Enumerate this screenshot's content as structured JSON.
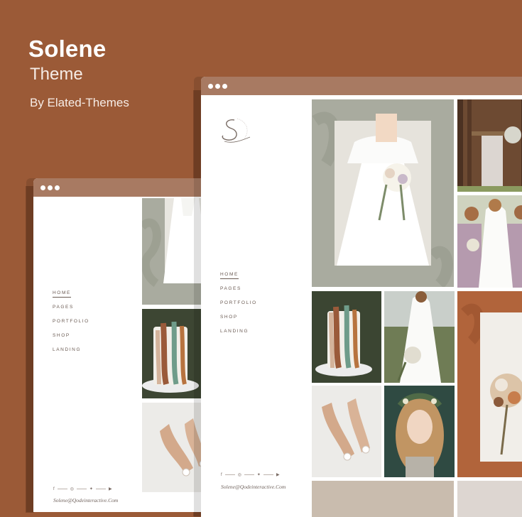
{
  "hero": {
    "title": "Solene",
    "subtitle": "Theme",
    "byline": "By Elated-Themes"
  },
  "colors": {
    "background": "#9b5a37",
    "window_bar": "#a87a62",
    "sage_panel": "#a9ab9f",
    "terracotta": "#b1643b"
  },
  "front_window": {
    "nav": [
      "HOME",
      "PAGES",
      "PORTFOLIO",
      "SHOP",
      "LANDING"
    ],
    "active_nav": "HOME",
    "email": "Solene@Qodeinteractive.Com"
  },
  "back_window": {
    "nav": [
      "HOME",
      "PAGES",
      "PORTFOLIO",
      "SHOP",
      "LANDING"
    ],
    "active_nav": "HOME",
    "email": "Solene@Qodeinteractive.Com"
  },
  "social_icons": [
    "facebook-icon",
    "instagram-icon",
    "twitter-icon",
    "youtube-icon"
  ],
  "photos": [
    "bride-with-bouquet",
    "forest-wedding-arch",
    "bridesmaids-in-lilac",
    "wedding-cake-with-feathers",
    "bride-in-field",
    "bouquet-on-terracotta",
    "bridal-heels",
    "woman-with-flower-crown"
  ]
}
